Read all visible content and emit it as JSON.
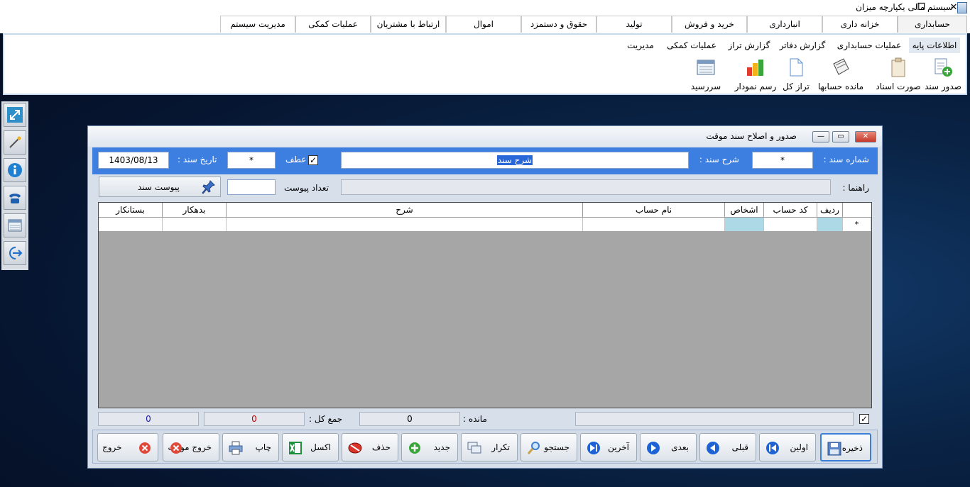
{
  "window": {
    "title": "سیستم مالی یکپارچه میزان",
    "restore_glyph": "❐",
    "close_glyph": "✕"
  },
  "menu": {
    "tabs": [
      "حسابداری",
      "خزانه داری",
      "انبارداری",
      "خرید و فروش",
      "تولید",
      "حقوق و دستمزد",
      "اموال",
      "ارتباط با مشتریان",
      "عملیات کمکی",
      "مدیریت سیستم"
    ]
  },
  "ribbon": {
    "subtabs": [
      "اطلاعات پایه",
      "عملیات حسابداری",
      "گزارش دفاتر",
      "گزارش تراز",
      "عملیات کمکی",
      "مدیریت"
    ],
    "buttons": [
      {
        "label": "صدور سند",
        "icon": "add-document-icon"
      },
      {
        "label": "صورت اسناد",
        "icon": "clipboard-icon"
      },
      {
        "label": "مانده حسابها",
        "icon": "notebook-icon"
      },
      {
        "label": "تراز کل",
        "icon": "file-icon"
      },
      {
        "label": "رسم نمودار",
        "icon": "bar-chart-icon"
      },
      {
        "label": "سررسید",
        "icon": "calendar-icon"
      }
    ]
  },
  "left_toolbar": [
    "resize-arrow-icon",
    "wand-icon",
    "info-icon",
    "phone-icon",
    "calendar-icon",
    "logout-arrow-icon"
  ],
  "dialog": {
    "title": "صدور و اصلاح سند موقت",
    "doc_number_label": "شماره سند :",
    "doc_number_value": "*",
    "doc_desc_label": "شرح سند :",
    "doc_desc_value": "شرح سند",
    "atf_label": "عطف",
    "atf_checked": true,
    "atf_value": "*",
    "doc_date_label": "تاریخ سند :",
    "doc_date_value": "1403/08/13",
    "guide_label": "راهنما :",
    "guide_value": "",
    "attach_count_label": "تعداد پیوست",
    "attach_count_value": "",
    "attach_button": "پیوست سند",
    "grid": {
      "columns": [
        "ردیف",
        "کد حساب",
        "اشخاص",
        "نام حساب",
        "شرح",
        "بدهکار",
        "بستانکار"
      ],
      "new_row_marker": "*"
    },
    "totals": {
      "checked": true,
      "remain_label": "مانده :",
      "remain_value": "0",
      "total_label": "جمع کل :",
      "debit_total": "0",
      "credit_total": "0"
    },
    "actions": [
      "ذخیره",
      "اولین",
      "قبلی",
      "بعدی",
      "آخرین",
      "جستجو",
      "تکرار",
      "جدید",
      "حذف",
      "اکسل",
      "چاپ",
      "خروج موقت",
      "خروج"
    ],
    "colors": {
      "accent": "#3d7fe0",
      "delete_red": "#d9332a",
      "nav_blue": "#1e63d6"
    }
  }
}
